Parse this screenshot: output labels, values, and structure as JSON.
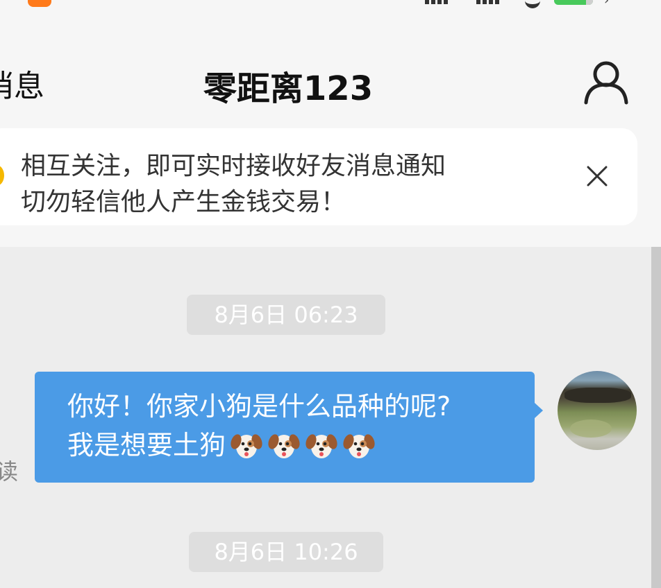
{
  "nav": {
    "back_label": "消息",
    "title": "零距离123",
    "profile_icon": "person-icon"
  },
  "notice": {
    "line1": "相互关注，即可实时接收好友消息通知",
    "line2": "切勿轻信他人产生金钱交易！",
    "close_icon": "close-icon"
  },
  "messages": [
    {
      "time": "8月6日 06:23",
      "line1": "你好！你家小狗是什么品种的呢?",
      "line2": "我是想要土狗",
      "emoji": [
        "dog-face-icon",
        "dog-face-icon",
        "dog-face-icon",
        "dog-face-icon"
      ],
      "status": "读"
    },
    {
      "time": "8月6日 10:26"
    }
  ],
  "colors": {
    "bubble": "#4b9be6",
    "background": "#ededed",
    "header": "#f6f6f6"
  }
}
